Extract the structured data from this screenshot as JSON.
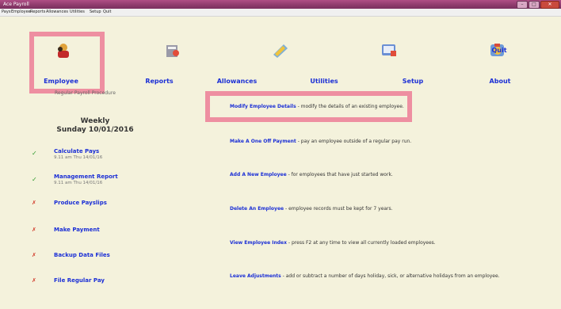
{
  "window": {
    "title": "Ace Payroll"
  },
  "menu": [
    "Pays",
    "Employee",
    "Reports",
    "Allowances",
    "Utilities",
    "Setup",
    "Quit"
  ],
  "toolbar": {
    "items": [
      {
        "label": "Employee",
        "icon": "employee-icon"
      },
      {
        "label": "Reports",
        "icon": "reports-icon"
      },
      {
        "label": "Allowances",
        "icon": "allowances-icon"
      },
      {
        "label": "Utilities",
        "icon": "utilities-icon"
      },
      {
        "label": "Setup",
        "icon": "setup-icon"
      },
      {
        "label": "About",
        "icon": ""
      }
    ],
    "quit_label": "Quit"
  },
  "procedure": {
    "text": "Regular Payroll Procedure"
  },
  "period": {
    "frequency": "Weekly",
    "date": "Sunday 10/01/2016"
  },
  "steps": [
    {
      "name": "Calculate Pays",
      "status": "done",
      "timestamp": "9.11 am Thu 14/01/16"
    },
    {
      "name": "Management Report",
      "status": "done",
      "timestamp": "9.11 am Thu 14/01/16"
    },
    {
      "name": "Produce Payslips",
      "status": "pending",
      "timestamp": ""
    },
    {
      "name": "Make Payment",
      "status": "pending",
      "timestamp": ""
    },
    {
      "name": "Backup Data Files",
      "status": "pending",
      "timestamp": ""
    },
    {
      "name": "File Regular Pay",
      "status": "pending",
      "timestamp": ""
    }
  ],
  "status_marks": {
    "done": "✓",
    "pending": "✗"
  },
  "tasks": [
    {
      "title": "Modify Employee Details",
      "desc": " - modify the details of an existing employee."
    },
    {
      "title": "Make A One Off Payment",
      "desc": " - pay an employee outside of a regular pay run."
    },
    {
      "title": "Add A New Employee",
      "desc": " - for employees that have just started work."
    },
    {
      "title": "Delete An Employee",
      "desc": " - employee records must be kept for 7 years."
    },
    {
      "title": "View Employee Index",
      "desc": " - press F2 at any time to view all currently loaded employees."
    },
    {
      "title": "Leave Adjustments",
      "desc": " - add or subtract a number of days holiday, sick, or alternative holidays from an employee."
    }
  ],
  "colors": {
    "accent": "#1b2fd6",
    "highlight": "#ee8fa1",
    "background": "#f4f2dc",
    "titlebar": "#8d3a6b"
  }
}
